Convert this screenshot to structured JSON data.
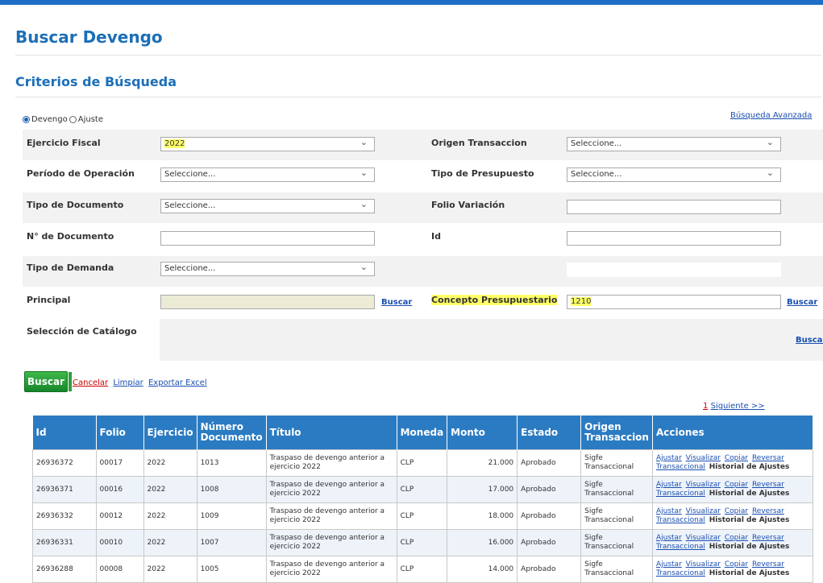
{
  "page": {
    "title": "Buscar Devengo",
    "subtitle": "Criterios de Búsqueda"
  },
  "radios": {
    "devengo": "Devengo",
    "ajuste": "Ajuste",
    "selected": "Devengo"
  },
  "advanced_link": "Búsqueda Avanzada",
  "form": {
    "ejercicio_fiscal": {
      "label": "Ejercicio Fiscal",
      "value": "2022"
    },
    "origen_transaccion": {
      "label": "Origen Transaccion",
      "value": "Seleccione..."
    },
    "periodo_operacion": {
      "label": "Período de Operación",
      "value": "Seleccione..."
    },
    "tipo_presupuesto": {
      "label": "Tipo de Presupuesto",
      "value": "Seleccione..."
    },
    "tipo_documento": {
      "label": "Tipo de Documento",
      "value": "Seleccione..."
    },
    "folio_variacion": {
      "label": "Folio Variación",
      "value": ""
    },
    "numero_documento": {
      "label": "N° de Documento",
      "value": ""
    },
    "id": {
      "label": "Id",
      "value": ""
    },
    "tipo_demanda": {
      "label": "Tipo de Demanda",
      "value": "Seleccione..."
    },
    "principal": {
      "label": "Principal",
      "value": "",
      "link": "Buscar"
    },
    "concepto_presupuestario": {
      "label": "Concepto Presupuestario",
      "value": "1210",
      "link": "Buscar"
    },
    "seleccion_catalogo": {
      "label": "Selección de Catálogo",
      "link": "Buscar"
    }
  },
  "actions": {
    "buscar": "Buscar",
    "cancelar": "Cancelar",
    "limpiar": "Limpiar",
    "exportar": "Exportar Excel"
  },
  "pager": {
    "current": "1",
    "next": "Siguiente >>"
  },
  "table": {
    "headers": [
      "Id",
      "Folio",
      "Ejercicio",
      "Número Documento",
      "Título",
      "Moneda",
      "Monto",
      "Estado",
      "Origen Transaccion",
      "Acciones"
    ],
    "rows": [
      {
        "id": "26936372",
        "folio": "00017",
        "ejercicio": "2022",
        "numero": "1013",
        "titulo": "Traspaso de devengo anterior a ejercicio 2022",
        "moneda": "CLP",
        "monto": "21.000",
        "estado": "Aprobado",
        "origen": "Sigfe Transaccional"
      },
      {
        "id": "26936371",
        "folio": "00016",
        "ejercicio": "2022",
        "numero": "1008",
        "titulo": "Traspaso de devengo anterior a ejercicio 2022",
        "moneda": "CLP",
        "monto": "17.000",
        "estado": "Aprobado",
        "origen": "Sigfe Transaccional"
      },
      {
        "id": "26936332",
        "folio": "00012",
        "ejercicio": "2022",
        "numero": "1009",
        "titulo": "Traspaso de devengo anterior a ejercicio 2022",
        "moneda": "CLP",
        "monto": "18.000",
        "estado": "Aprobado",
        "origen": "Sigfe Transaccional"
      },
      {
        "id": "26936331",
        "folio": "00010",
        "ejercicio": "2022",
        "numero": "1007",
        "titulo": "Traspaso de devengo anterior a ejercicio 2022",
        "moneda": "CLP",
        "monto": "16.000",
        "estado": "Aprobado",
        "origen": "Sigfe Transaccional"
      },
      {
        "id": "26936288",
        "folio": "00008",
        "ejercicio": "2022",
        "numero": "1005",
        "titulo": "Traspaso de devengo anterior a ejercicio 2022",
        "moneda": "CLP",
        "monto": "14.000",
        "estado": "Aprobado",
        "origen": "Sigfe Transaccional"
      }
    ],
    "row_actions": {
      "ajustar": "Ajustar",
      "visualizar": "Visualizar",
      "copiar": "Copiar",
      "reversar": "Reversar",
      "transaccional": "Transaccional",
      "historial": "Historial de Ajustes"
    }
  },
  "colors": {
    "brand": "#1b6fb8",
    "header": "#2b7bc2",
    "highlight": "#ffff66",
    "button": "#2a9a3a"
  }
}
